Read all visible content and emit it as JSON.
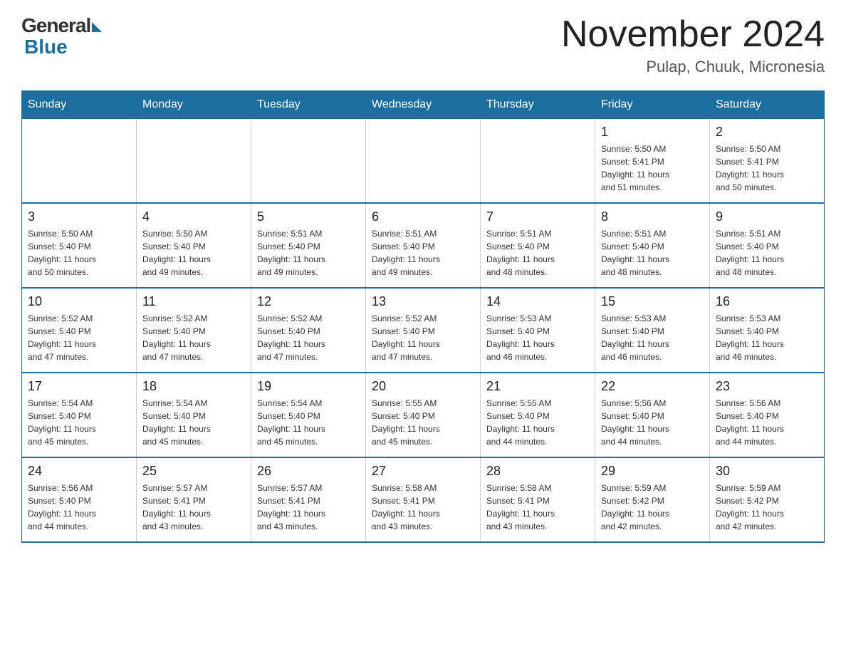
{
  "logo": {
    "general": "General",
    "blue": "Blue"
  },
  "title": "November 2024",
  "location": "Pulap, Chuuk, Micronesia",
  "weekdays": [
    "Sunday",
    "Monday",
    "Tuesday",
    "Wednesday",
    "Thursday",
    "Friday",
    "Saturday"
  ],
  "rows": [
    [
      {
        "day": "",
        "info": ""
      },
      {
        "day": "",
        "info": ""
      },
      {
        "day": "",
        "info": ""
      },
      {
        "day": "",
        "info": ""
      },
      {
        "day": "",
        "info": ""
      },
      {
        "day": "1",
        "info": "Sunrise: 5:50 AM\nSunset: 5:41 PM\nDaylight: 11 hours\nand 51 minutes."
      },
      {
        "day": "2",
        "info": "Sunrise: 5:50 AM\nSunset: 5:41 PM\nDaylight: 11 hours\nand 50 minutes."
      }
    ],
    [
      {
        "day": "3",
        "info": "Sunrise: 5:50 AM\nSunset: 5:40 PM\nDaylight: 11 hours\nand 50 minutes."
      },
      {
        "day": "4",
        "info": "Sunrise: 5:50 AM\nSunset: 5:40 PM\nDaylight: 11 hours\nand 49 minutes."
      },
      {
        "day": "5",
        "info": "Sunrise: 5:51 AM\nSunset: 5:40 PM\nDaylight: 11 hours\nand 49 minutes."
      },
      {
        "day": "6",
        "info": "Sunrise: 5:51 AM\nSunset: 5:40 PM\nDaylight: 11 hours\nand 49 minutes."
      },
      {
        "day": "7",
        "info": "Sunrise: 5:51 AM\nSunset: 5:40 PM\nDaylight: 11 hours\nand 48 minutes."
      },
      {
        "day": "8",
        "info": "Sunrise: 5:51 AM\nSunset: 5:40 PM\nDaylight: 11 hours\nand 48 minutes."
      },
      {
        "day": "9",
        "info": "Sunrise: 5:51 AM\nSunset: 5:40 PM\nDaylight: 11 hours\nand 48 minutes."
      }
    ],
    [
      {
        "day": "10",
        "info": "Sunrise: 5:52 AM\nSunset: 5:40 PM\nDaylight: 11 hours\nand 47 minutes."
      },
      {
        "day": "11",
        "info": "Sunrise: 5:52 AM\nSunset: 5:40 PM\nDaylight: 11 hours\nand 47 minutes."
      },
      {
        "day": "12",
        "info": "Sunrise: 5:52 AM\nSunset: 5:40 PM\nDaylight: 11 hours\nand 47 minutes."
      },
      {
        "day": "13",
        "info": "Sunrise: 5:52 AM\nSunset: 5:40 PM\nDaylight: 11 hours\nand 47 minutes."
      },
      {
        "day": "14",
        "info": "Sunrise: 5:53 AM\nSunset: 5:40 PM\nDaylight: 11 hours\nand 46 minutes."
      },
      {
        "day": "15",
        "info": "Sunrise: 5:53 AM\nSunset: 5:40 PM\nDaylight: 11 hours\nand 46 minutes."
      },
      {
        "day": "16",
        "info": "Sunrise: 5:53 AM\nSunset: 5:40 PM\nDaylight: 11 hours\nand 46 minutes."
      }
    ],
    [
      {
        "day": "17",
        "info": "Sunrise: 5:54 AM\nSunset: 5:40 PM\nDaylight: 11 hours\nand 45 minutes."
      },
      {
        "day": "18",
        "info": "Sunrise: 5:54 AM\nSunset: 5:40 PM\nDaylight: 11 hours\nand 45 minutes."
      },
      {
        "day": "19",
        "info": "Sunrise: 5:54 AM\nSunset: 5:40 PM\nDaylight: 11 hours\nand 45 minutes."
      },
      {
        "day": "20",
        "info": "Sunrise: 5:55 AM\nSunset: 5:40 PM\nDaylight: 11 hours\nand 45 minutes."
      },
      {
        "day": "21",
        "info": "Sunrise: 5:55 AM\nSunset: 5:40 PM\nDaylight: 11 hours\nand 44 minutes."
      },
      {
        "day": "22",
        "info": "Sunrise: 5:56 AM\nSunset: 5:40 PM\nDaylight: 11 hours\nand 44 minutes."
      },
      {
        "day": "23",
        "info": "Sunrise: 5:56 AM\nSunset: 5:40 PM\nDaylight: 11 hours\nand 44 minutes."
      }
    ],
    [
      {
        "day": "24",
        "info": "Sunrise: 5:56 AM\nSunset: 5:40 PM\nDaylight: 11 hours\nand 44 minutes."
      },
      {
        "day": "25",
        "info": "Sunrise: 5:57 AM\nSunset: 5:41 PM\nDaylight: 11 hours\nand 43 minutes."
      },
      {
        "day": "26",
        "info": "Sunrise: 5:57 AM\nSunset: 5:41 PM\nDaylight: 11 hours\nand 43 minutes."
      },
      {
        "day": "27",
        "info": "Sunrise: 5:58 AM\nSunset: 5:41 PM\nDaylight: 11 hours\nand 43 minutes."
      },
      {
        "day": "28",
        "info": "Sunrise: 5:58 AM\nSunset: 5:41 PM\nDaylight: 11 hours\nand 43 minutes."
      },
      {
        "day": "29",
        "info": "Sunrise: 5:59 AM\nSunset: 5:42 PM\nDaylight: 11 hours\nand 42 minutes."
      },
      {
        "day": "30",
        "info": "Sunrise: 5:59 AM\nSunset: 5:42 PM\nDaylight: 11 hours\nand 42 minutes."
      }
    ]
  ]
}
